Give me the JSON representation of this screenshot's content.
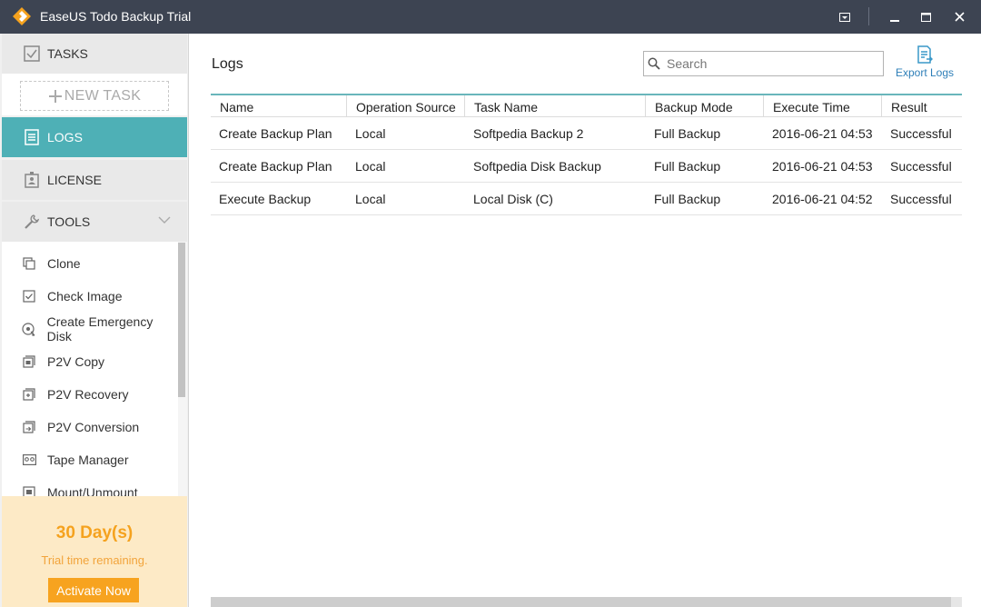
{
  "window": {
    "title": "EaseUS Todo Backup Trial"
  },
  "sidebar": {
    "tasks_label": "TASKS",
    "new_task_label": "NEW TASK",
    "logs_label": "LOGS",
    "license_label": "LICENSE",
    "tools_label": "TOOLS",
    "tools": [
      {
        "label": "Clone",
        "icon": "clone-icon"
      },
      {
        "label": "Check Image",
        "icon": "check-image-icon"
      },
      {
        "label": "Create Emergency Disk",
        "icon": "emergency-disk-icon"
      },
      {
        "label": "P2V Copy",
        "icon": "p2v-copy-icon"
      },
      {
        "label": "P2V Recovery",
        "icon": "p2v-recovery-icon"
      },
      {
        "label": "P2V Conversion",
        "icon": "p2v-conversion-icon"
      },
      {
        "label": "Tape Manager",
        "icon": "tape-manager-icon"
      },
      {
        "label": "Mount/Unmount",
        "icon": "mount-icon"
      }
    ],
    "trial": {
      "days": "30 Day(s)",
      "remaining": "Trial time remaining.",
      "activate_label": "Activate Now"
    }
  },
  "main": {
    "title": "Logs",
    "search_placeholder": "Search",
    "export_label": "Export Logs",
    "columns": [
      "Name",
      "Operation Source",
      "Task Name",
      "Backup Mode",
      "Execute Time",
      "Result"
    ],
    "rows": [
      [
        "Create Backup Plan",
        "Local",
        "Softpedia Backup 2",
        "Full Backup",
        "2016-06-21 04:53",
        "Successful"
      ],
      [
        "Create Backup Plan",
        "Local",
        "Softpedia Disk Backup",
        "Full Backup",
        "2016-06-21 04:53",
        "Successful"
      ],
      [
        "Execute Backup",
        "Local",
        "Local Disk (C)",
        "Full Backup",
        "2016-06-21 04:52",
        "Successful"
      ]
    ]
  },
  "colors": {
    "titlebar": "#3d4452",
    "accent": "#4eb0b6",
    "trial_bg": "#fdeac6",
    "trial_orange": "#f7a31f",
    "link_blue": "#2e7fb8"
  }
}
